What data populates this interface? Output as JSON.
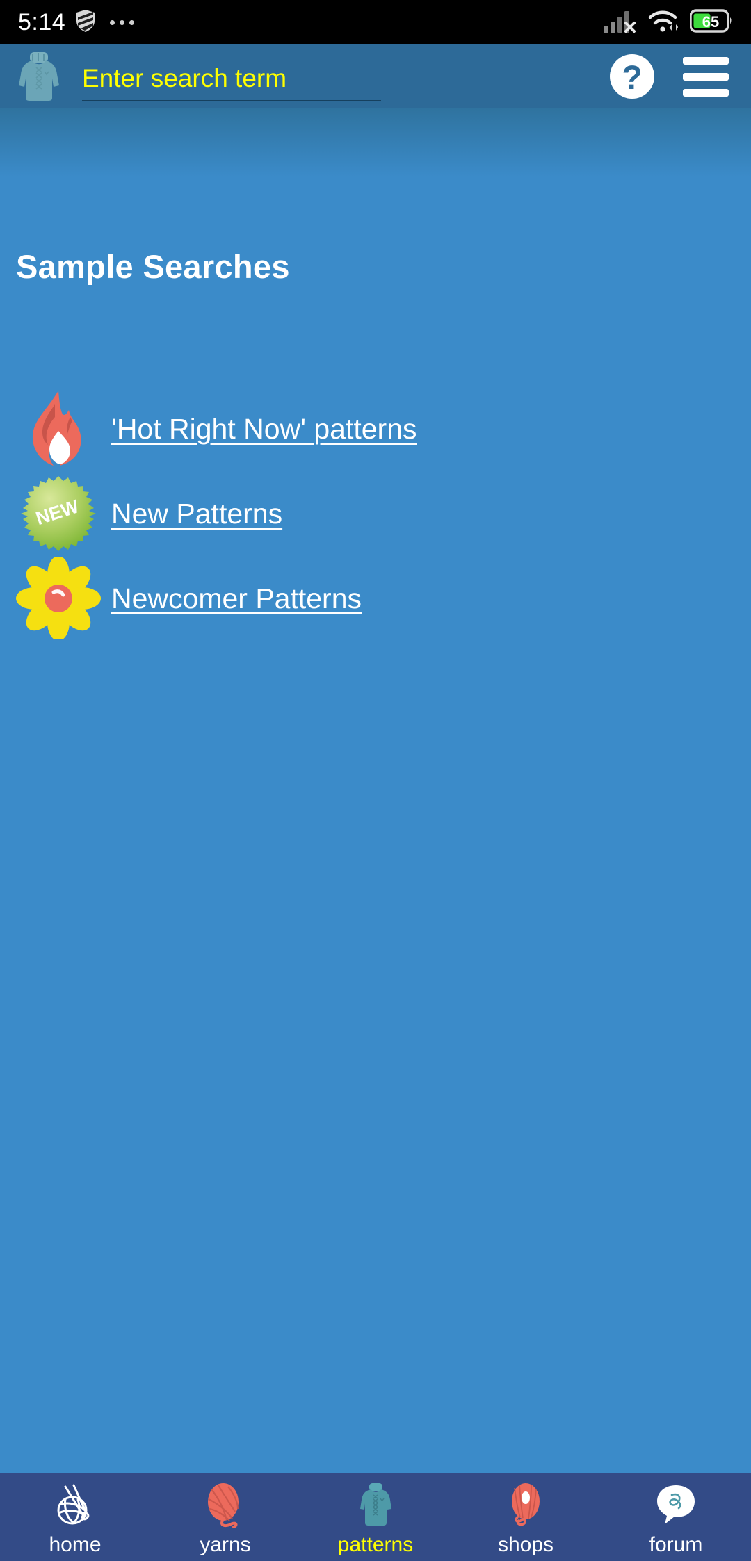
{
  "status_bar": {
    "time": "5:14",
    "icons": [
      "shield-vpn-icon",
      "overflow-dots-icon",
      "cellular-signal-no-service-icon",
      "wifi-icon",
      "battery-icon"
    ],
    "battery_percent": "65",
    "battery_color": "#3ddc3d",
    "background": "#000000"
  },
  "app_bar": {
    "background": "#2d6a98",
    "logo_icon": "sweater-logo-icon",
    "search": {
      "value": "",
      "placeholder": "Enter search term",
      "text_color": "#ffff00"
    },
    "help_icon": "help-question-circle-icon",
    "help_label": "?",
    "menu_icon": "hamburger-menu-icon"
  },
  "main": {
    "background": "#3b8bc9",
    "title": "Sample Searches",
    "sample_searches": [
      {
        "label": "'Hot Right Now' patterns",
        "icon": "flame-icon",
        "icon_color": "#ec6a5c"
      },
      {
        "label": "New Patterns",
        "icon": "new-starburst-badge-icon",
        "icon_color": "#8dc63f",
        "badge_text": "NEW"
      },
      {
        "label": "Newcomer Patterns",
        "icon": "flower-icon",
        "icon_color": "#f5e011"
      }
    ]
  },
  "bottom_nav": {
    "background": "#334b87",
    "active_color": "#ffff00",
    "items": [
      {
        "label": "home",
        "icon": "yarn-ball-needles-icon",
        "active": false
      },
      {
        "label": "yarns",
        "icon": "yarn-ball-icon",
        "active": false
      },
      {
        "label": "patterns",
        "icon": "sweater-icon",
        "active": true
      },
      {
        "label": "shops",
        "icon": "yarn-skein-icon",
        "active": false
      },
      {
        "label": "forum",
        "icon": "speech-bubble-icon",
        "active": false
      }
    ]
  }
}
